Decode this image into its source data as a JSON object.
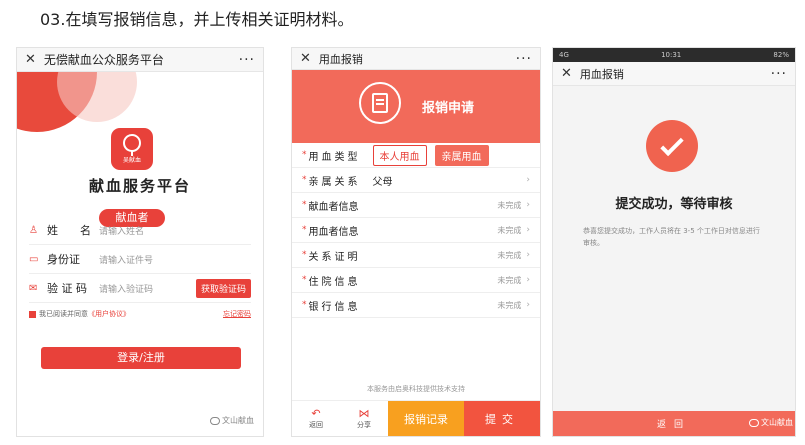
{
  "heading": "03.在填写报销信息，并上传相关证明材料。",
  "phone1": {
    "window_title": "无偿献血公众服务平台",
    "logo_text": "吴献血",
    "title": "献血服务平台",
    "role_pill": "献血者",
    "fields": [
      {
        "label": "姓　　名",
        "placeholder": "请输入姓名",
        "icon": "user-icon"
      },
      {
        "label": "身份证",
        "placeholder": "请输入证件号",
        "icon": "id-card-icon"
      },
      {
        "label": "验 证 码",
        "placeholder": "请输入验证码",
        "icon": "envelope-icon"
      }
    ],
    "code_button": "获取验证码",
    "agree_prefix": "我已阅读并同意",
    "agree_link": "《用户协议》",
    "forgot": "忘记密码",
    "login_button": "登录/注册",
    "watermark": "文山献血"
  },
  "phone2": {
    "window_title": "用血报销",
    "banner_title": "报销申请",
    "rows": [
      {
        "label": "用血类型",
        "value": "",
        "status": "",
        "type": "options"
      },
      {
        "label": "亲属关系",
        "value": "父母",
        "status": "",
        "type": "value"
      },
      {
        "label": "献血者信息",
        "value": "",
        "status": "未完成",
        "type": "status"
      },
      {
        "label": "用血者信息",
        "value": "",
        "status": "未完成",
        "type": "status"
      },
      {
        "label": "关系证明",
        "value": "",
        "status": "未完成",
        "type": "status"
      },
      {
        "label": "住院信息",
        "value": "",
        "status": "未完成",
        "type": "status"
      },
      {
        "label": "银行信息",
        "value": "",
        "status": "未完成",
        "type": "status"
      }
    ],
    "option_self": "本人用血",
    "option_family": "亲属用血",
    "footnote": "本服务由启奥科技提供技术支持",
    "nav_back": "返回",
    "nav_share": "分享",
    "records_button": "报销记录",
    "submit_button": "提交",
    "watermark": "文山献血"
  },
  "phone3": {
    "status_left": "4G",
    "status_time": "10:31",
    "status_right": "82%",
    "window_title": "用血报销",
    "success_title": "提交成功，等待审核",
    "success_desc": "恭喜您提交成功，工作人员将在 3-5 个工作日对信息进行审核。",
    "back_button": "返回",
    "watermark": "文山献血"
  },
  "colors": {
    "accent": "#e8413a",
    "banner": "#f26a5a",
    "orange": "#f8a01f"
  }
}
